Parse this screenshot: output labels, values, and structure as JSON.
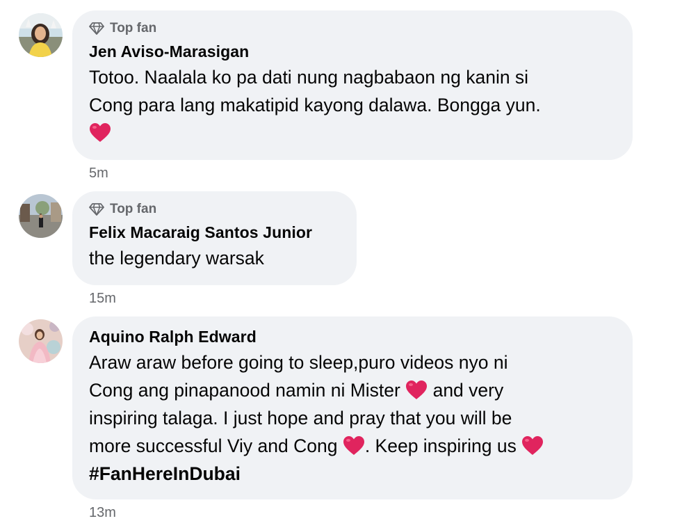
{
  "colors": {
    "bubble_bg": "#f0f2f5",
    "secondary_text": "#65676b",
    "heart": "#e0245e"
  },
  "comments": [
    {
      "badge": "Top fan",
      "badge_icon": "diamond-icon",
      "author": "Jen Aviso-Marasigan",
      "line1": "Totoo. Naalala ko pa dati nung nagbabaon ng kanin si",
      "line2": "Cong para lang makatipid kayong dalawa. Bongga yun.",
      "time": "5m"
    },
    {
      "badge": "Top fan",
      "badge_icon": "diamond-icon",
      "author": "Felix Macaraig Santos Junior",
      "line1": "the legendary warsak",
      "time": "15m"
    },
    {
      "author": "Aquino Ralph Edward",
      "line1": "Araw araw before going to sleep,puro videos nyo ni",
      "line2a": "Cong ang pinapanood namin ni Mister ",
      "line2b": " and very",
      "line3": "inspiring talaga. I just hope and pray that you will be",
      "line4a": "more successful Viy and Cong ",
      "line4b": ". Keep inspiring us ",
      "hashtag": "#FanHereInDubai",
      "time": "13m"
    }
  ]
}
